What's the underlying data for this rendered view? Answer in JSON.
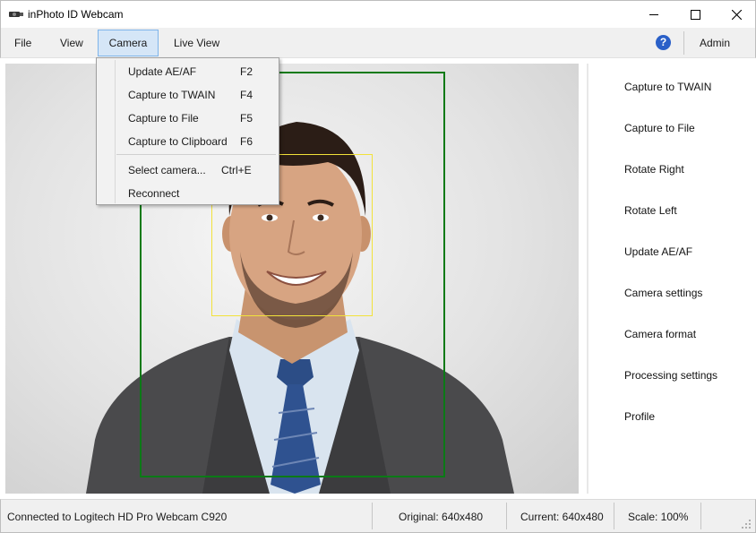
{
  "window": {
    "title": "inPhoto ID Webcam",
    "icons": {
      "app": "webcam-app-icon",
      "minimize": "minimize-icon",
      "maximize": "maximize-icon",
      "close": "close-icon"
    }
  },
  "menubar": {
    "file": "File",
    "view": "View",
    "camera": "Camera",
    "live_view": "Live View",
    "help_icon": "?",
    "admin": "Admin"
  },
  "camera_menu": {
    "items": [
      {
        "label": "Update AE/AF",
        "shortcut": "F2"
      },
      {
        "label": "Capture to TWAIN",
        "shortcut": "F4"
      },
      {
        "label": "Capture to File",
        "shortcut": "F5"
      },
      {
        "label": "Capture to Clipboard",
        "shortcut": "F6"
      },
      {
        "label": "Select camera...",
        "shortcut": "Ctrl+E"
      },
      {
        "label": "Reconnect",
        "shortcut": ""
      }
    ]
  },
  "side_panel": {
    "buttons": [
      "Capture to TWAIN",
      "Capture to File",
      "Rotate Right",
      "Rotate Left",
      "Update AE/AF",
      "Camera settings",
      "Camera format",
      "Processing settings",
      "Profile"
    ]
  },
  "status": {
    "connection": "Connected to Logitech HD Pro Webcam C920",
    "original": "Original: 640x480",
    "current": "Current: 640x480",
    "scale": "Scale: 100%"
  },
  "colors": {
    "crop_frame": "#0b7a16",
    "face_frame": "#f2e23a",
    "menu_highlight": "#d5e6f7",
    "help_icon": "#2a60c8"
  }
}
